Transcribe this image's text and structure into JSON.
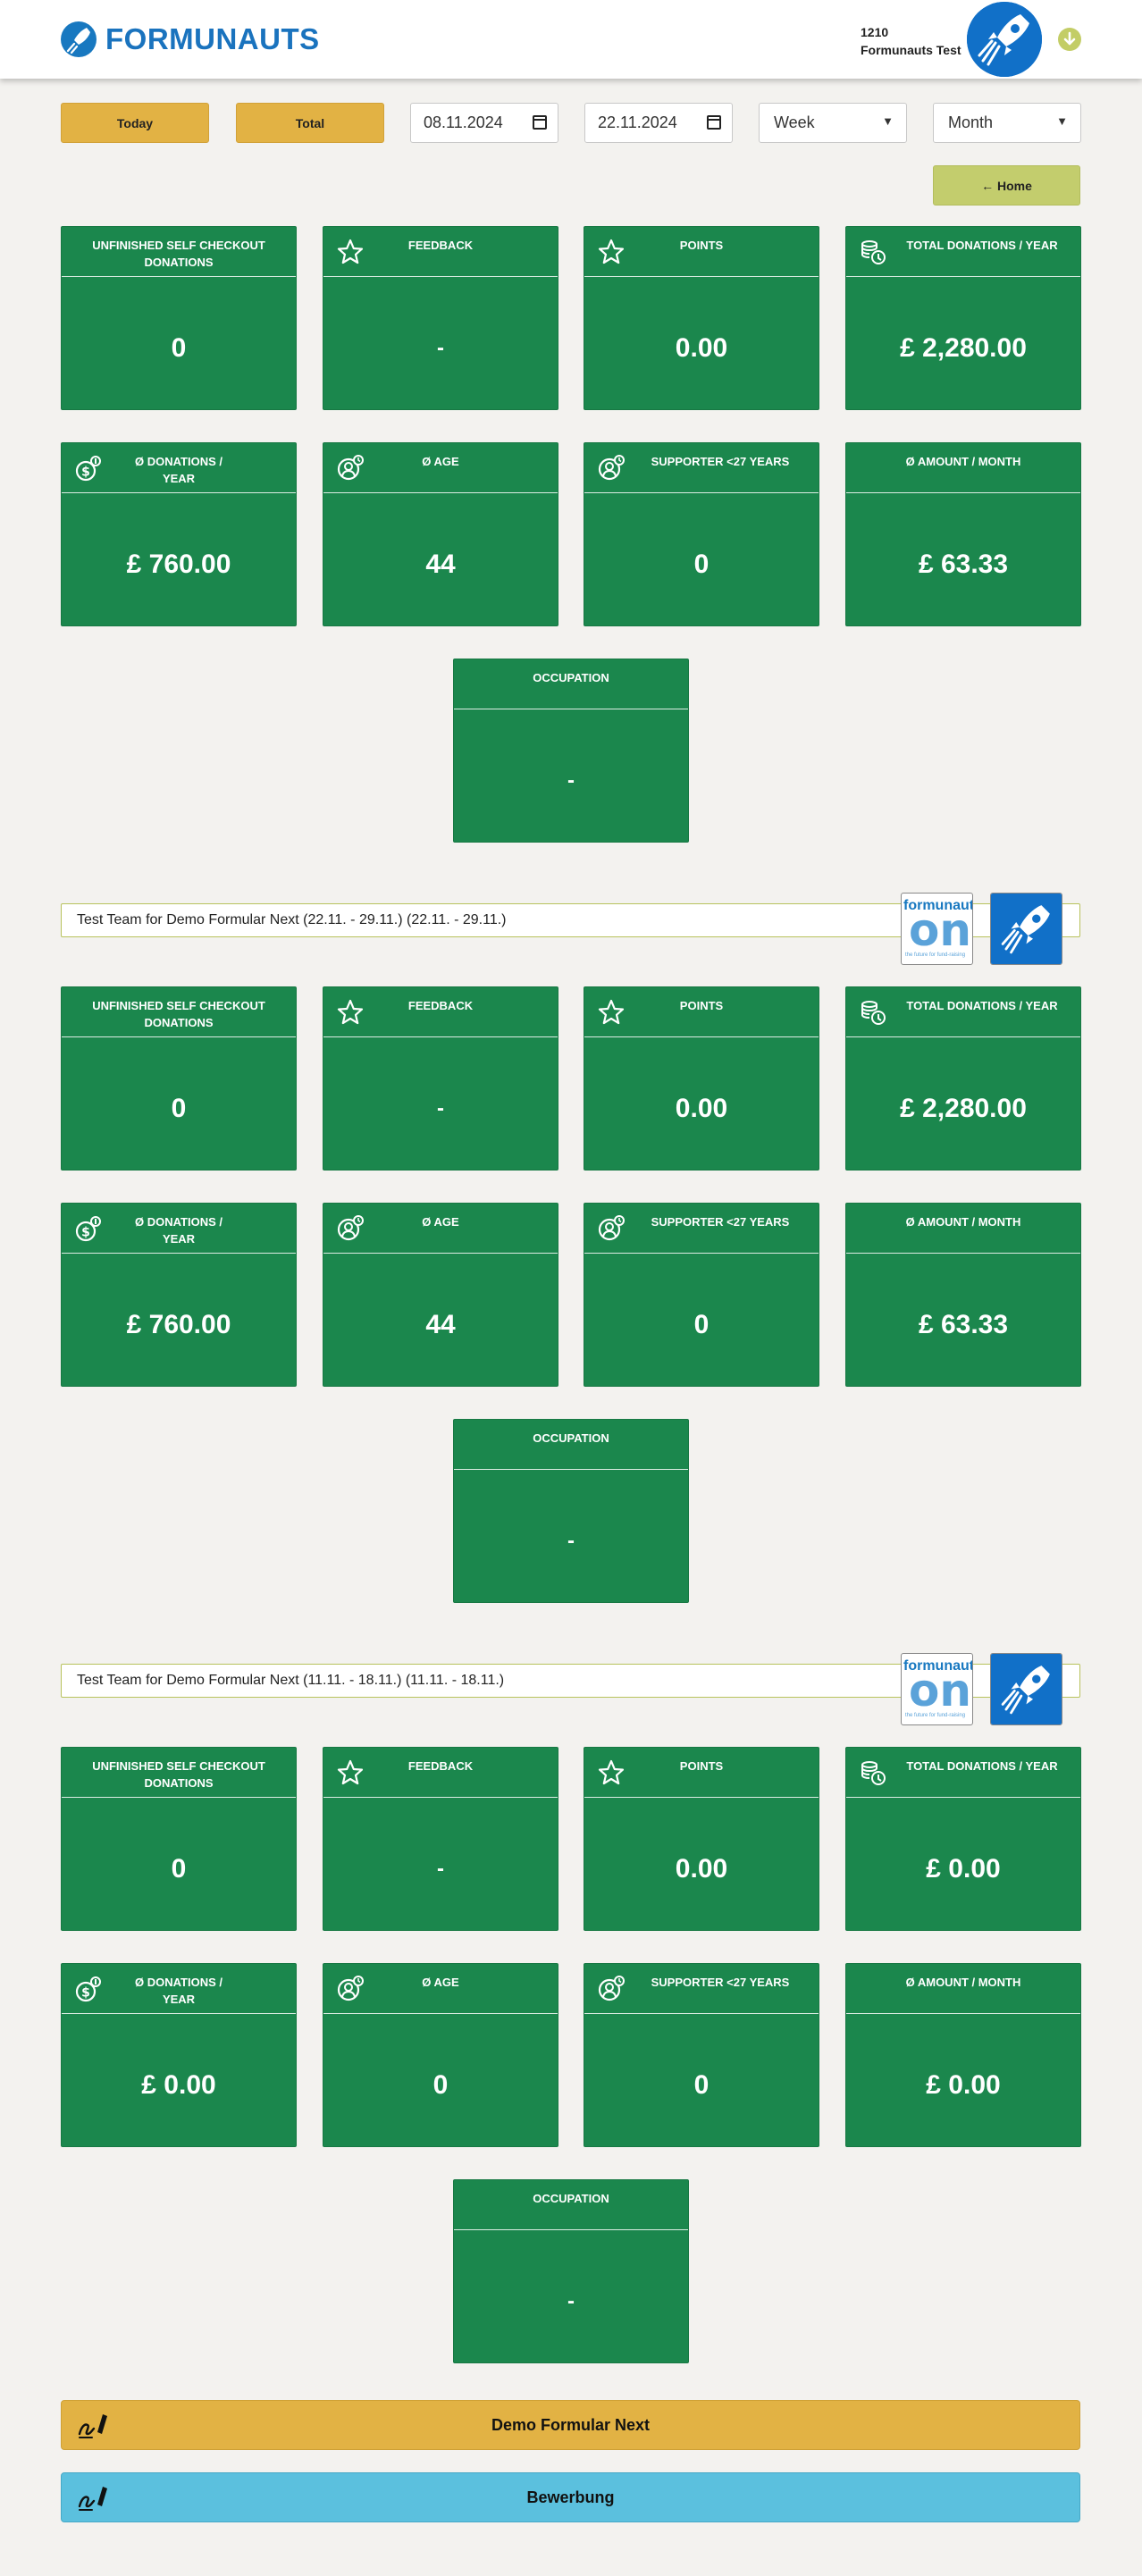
{
  "header": {
    "brand": "FORMUNAUTS",
    "user_id": "1210",
    "user_name": "Formunauts Test"
  },
  "toolbar": {
    "today_label": "Today",
    "total_label": "Total",
    "date_from": "08.11.2024",
    "date_to": "22.11.2024",
    "interval_select": "Week",
    "period_select": "Month",
    "home_label": "← Home"
  },
  "icons": {
    "feedback": "star-icon",
    "points": "star-icon",
    "total_donations": "coins-icon",
    "avg_donations": "dollar-coin-icon",
    "age": "person-icon",
    "supporter": "person-icon",
    "action": "signature-icon"
  },
  "colors": {
    "tile_green": "#1b874d",
    "accent_yellow": "#e2b244",
    "home_green": "#c3cd6d",
    "info_blue": "#5bc0de",
    "brand_blue": "#1a73be"
  },
  "sections": [
    {
      "team": "",
      "stats": {
        "unfinished_label": "Unfinished self checkout donations",
        "unfinished": "0",
        "feedback_label": "Feedback",
        "feedback": "-",
        "points_label": "Points",
        "points": "0.00",
        "total_label": "Total donations / year",
        "total": "£ 2,280.00",
        "avg_label": "Ø Donations / year",
        "avg": "£ 760.00",
        "age_label": "Ø Age",
        "age": "44",
        "supporter_label": "Supporter <27 years",
        "supporter": "0",
        "month_label": "Ø Amount / month",
        "month": "£ 63.33",
        "occupation_label": "Occupation",
        "occupation": "-"
      }
    },
    {
      "team": "Test Team for Demo Formular Next (22.11. - 29.11.) (22.11. - 29.11.)",
      "badge_top": "formunauts",
      "badge_mid": "one",
      "badge_sub": "the future for fund-raising",
      "stats": {
        "unfinished_label": "Unfinished self checkout donations",
        "unfinished": "0",
        "feedback_label": "Feedback",
        "feedback": "-",
        "points_label": "Points",
        "points": "0.00",
        "total_label": "Total donations / year",
        "total": "£ 2,280.00",
        "avg_label": "Ø Donations / year",
        "avg": "£ 760.00",
        "age_label": "Ø Age",
        "age": "44",
        "supporter_label": "Supporter <27 years",
        "supporter": "0",
        "month_label": "Ø Amount / month",
        "month": "£ 63.33",
        "occupation_label": "Occupation",
        "occupation": "-"
      }
    },
    {
      "team": "Test Team for Demo Formular Next (11.11. - 18.11.) (11.11. - 18.11.)",
      "badge_top": "formunauts",
      "badge_mid": "one",
      "badge_sub": "the future for fund-raising",
      "stats": {
        "unfinished_label": "Unfinished self checkout donations",
        "unfinished": "0",
        "feedback_label": "Feedback",
        "feedback": "-",
        "points_label": "Points",
        "points": "0.00",
        "total_label": "Total donations / year",
        "total": "£ 0.00",
        "avg_label": "Ø Donations / year",
        "avg": "£ 0.00",
        "age_label": "Ø Age",
        "age": "0",
        "supporter_label": "Supporter <27 years",
        "supporter": "0",
        "month_label": "Ø Amount / month",
        "month": "£ 0.00",
        "occupation_label": "Occupation",
        "occupation": "-"
      }
    }
  ],
  "actions": {
    "demo_label": "Demo Formular Next",
    "bewerbung_label": "Bewerbung"
  }
}
